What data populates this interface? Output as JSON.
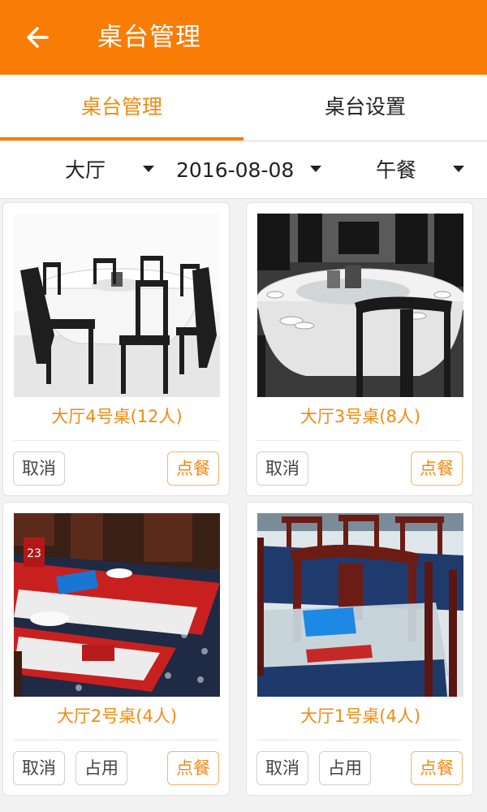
{
  "header": {
    "title": "桌台管理",
    "back_icon": "back-arrow-icon"
  },
  "tabs": [
    {
      "label": "桌台管理",
      "active": true
    },
    {
      "label": "桌台设置",
      "active": false
    }
  ],
  "filters": {
    "area": "大厅",
    "date": "2016-08-08",
    "meal": "午餐"
  },
  "tables": [
    {
      "name": "大厅4号桌(12人)",
      "buttons": {
        "cancel": "取消",
        "order": "点餐"
      }
    },
    {
      "name": "大厅3号桌(8人)",
      "buttons": {
        "cancel": "取消",
        "order": "点餐"
      }
    },
    {
      "name": "大厅2号桌(4人)",
      "buttons": {
        "cancel": "取消",
        "occupy": "占用",
        "order": "点餐"
      }
    },
    {
      "name": "大厅1号桌(4人)",
      "buttons": {
        "cancel": "取消",
        "occupy": "占用",
        "order": "点餐"
      }
    }
  ],
  "colors": {
    "accent": "#f97c05",
    "accent_text": "#f28a12"
  }
}
